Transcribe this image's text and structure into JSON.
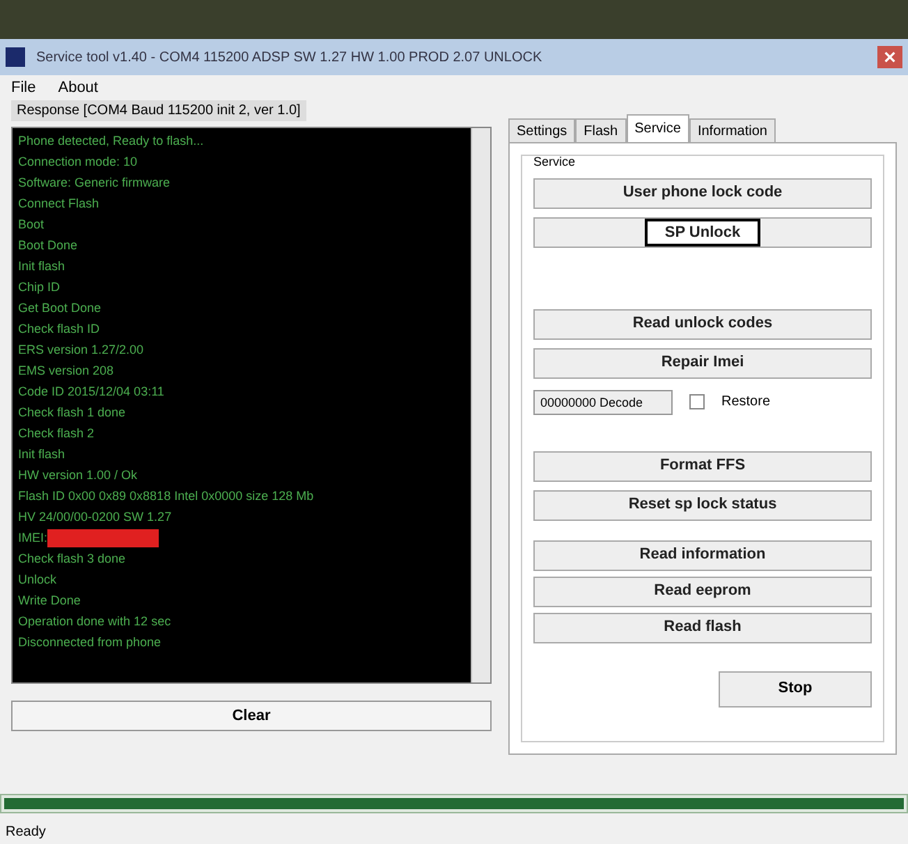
{
  "window": {
    "title": "Service tool v1.40 - COM4 115200 ADSP SW 1.27 HW 1.00 PROD 2.07 UNLOCK"
  },
  "menu": [
    "File",
    "About"
  ],
  "response": {
    "label": "Response [COM4 Baud 115200 init 2, ver 1.0]",
    "lines": [
      {
        "text": "Phone detected, Ready to flash...",
        "redacted": false
      },
      {
        "text": "Connection mode: 10",
        "redacted": false
      },
      {
        "text": "Software: Generic firmware",
        "redacted": false
      },
      {
        "text": "Connect Flash",
        "redacted": false
      },
      {
        "text": "Boot",
        "redacted": false
      },
      {
        "text": "Boot Done",
        "redacted": false
      },
      {
        "text": "Init flash",
        "redacted": false
      },
      {
        "text": "Chip ID",
        "redacted": false
      },
      {
        "text": "Get Boot Done",
        "redacted": false
      },
      {
        "text": "Check flash ID",
        "redacted": false
      },
      {
        "text": "ERS version 1.27/2.00",
        "redacted": false
      },
      {
        "text": "EMS version 208",
        "redacted": false
      },
      {
        "text": "Code ID 2015/12/04 03:11",
        "redacted": false
      },
      {
        "text": "Check flash 1 done",
        "redacted": false
      },
      {
        "text": "Check flash 2",
        "redacted": false
      },
      {
        "text": "Init flash",
        "redacted": false
      },
      {
        "text": "HW version 1.00 / Ok",
        "redacted": false
      },
      {
        "text": "Flash ID 0x00 0x89 0x8818 Intel 0x0000 size 128 Mb",
        "redacted": false
      },
      {
        "text": "HV 24/00/00-0200 SW 1.27",
        "redacted": false
      },
      {
        "text": "IMEI: ",
        "redacted": true
      },
      {
        "text": "Check flash 3 done",
        "redacted": false
      },
      {
        "text": "Unlock",
        "redacted": false
      },
      {
        "text": "Write Done",
        "redacted": false
      },
      {
        "text": "Operation done with 12 sec",
        "redacted": false
      },
      {
        "text": "Disconnected from phone",
        "redacted": false
      }
    ],
    "button": "Clear"
  },
  "tabs": [
    {
      "label": "Settings",
      "selected": false
    },
    {
      "label": "Flash",
      "selected": false
    },
    {
      "label": "Service",
      "selected": true
    },
    {
      "label": "Information",
      "selected": false
    }
  ],
  "service": {
    "group": "Service",
    "buttons_top": [
      {
        "label": "User phone lock code",
        "focused": false
      },
      {
        "label": "SP Unlock",
        "focused": true
      }
    ],
    "buttons_mid": [
      {
        "label": "Read unlock codes",
        "focused": false
      },
      {
        "label": "Repair Imei",
        "focused": false
      }
    ],
    "imei_field": {
      "value": "00000000 Decode"
    },
    "restore": {
      "label": "Restore",
      "checked": false
    },
    "buttons_low": [
      {
        "label": "Format FFS",
        "focused": false
      },
      {
        "label": "Reset sp lock status",
        "focused": false
      }
    ],
    "buttons_read": [
      {
        "label": "Read information",
        "focused": false
      },
      {
        "label": "Read eeprom",
        "focused": false
      },
      {
        "label": "Read flash",
        "focused": false
      }
    ],
    "stop": "Stop"
  },
  "progress": {
    "level": 1
  },
  "status_bar": "Ready"
}
